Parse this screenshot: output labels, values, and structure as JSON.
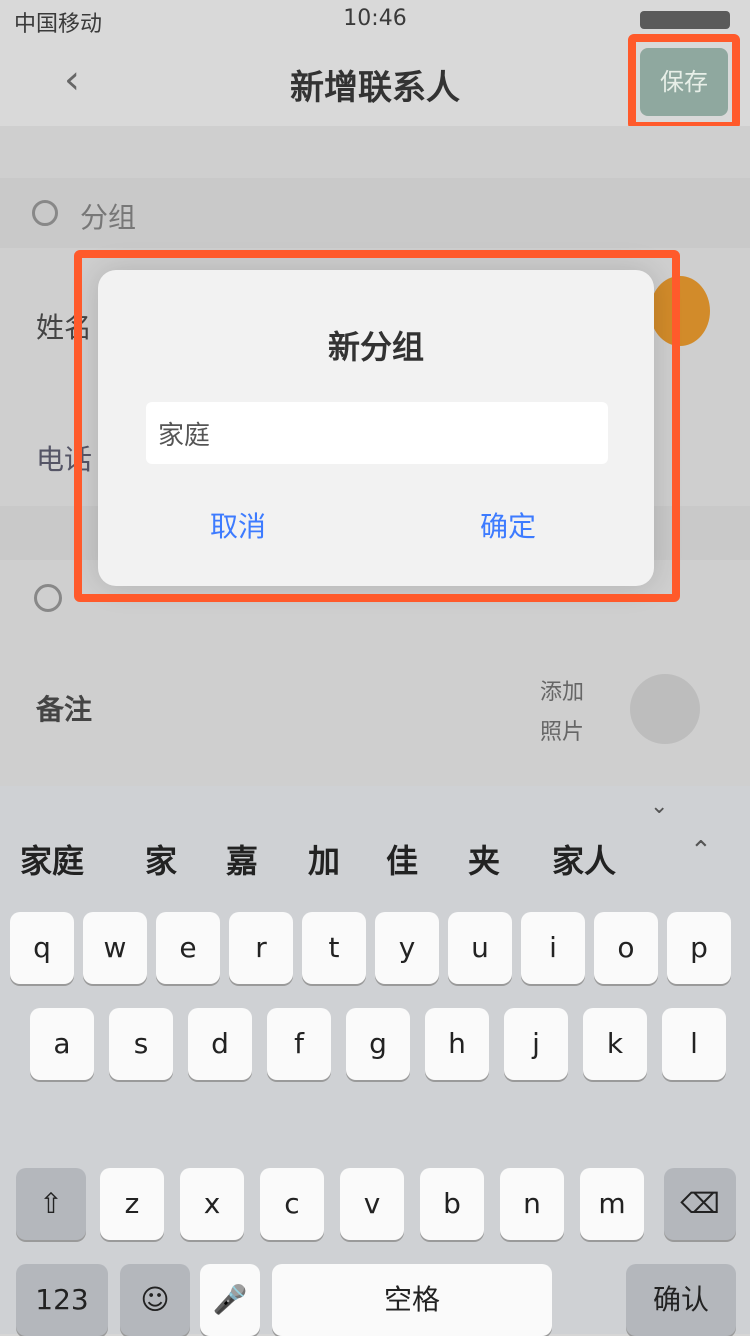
{
  "status_bar": {
    "carrier": "中国移动",
    "time": "10:46",
    "battery": ""
  },
  "nav": {
    "title": "新增联系人",
    "save_label": "保存"
  },
  "content": {
    "section_title": "分组",
    "row1_label": "姓名",
    "row2_label": "电话",
    "section2_title": "",
    "row3_label": "备注",
    "right_label_top": "添加",
    "right_label_bottom": "照片"
  },
  "modal": {
    "title": "新分组",
    "input_value": "家庭",
    "cancel_label": "取消",
    "confirm_label": "确定"
  },
  "keyboard": {
    "candidates": [
      "家庭",
      "家",
      "嘉",
      "加",
      "佳",
      "夹",
      "家人"
    ],
    "row1": [
      "q",
      "w",
      "e",
      "r",
      "t",
      "y",
      "u",
      "i",
      "o",
      "p"
    ],
    "row2": [
      "a",
      "s",
      "d",
      "f",
      "g",
      "h",
      "j",
      "k",
      "l"
    ],
    "row3": [
      "z",
      "x",
      "c",
      "v",
      "b",
      "n",
      "m"
    ],
    "bottom": {
      "left": "123",
      "emoji": "☺",
      "mic": "🎤",
      "space": "空格",
      "return": "确认"
    }
  },
  "colors": {
    "accent": "#3d7bff",
    "highlight": "#ff5a2b",
    "save_bg": "#8fa89f"
  }
}
